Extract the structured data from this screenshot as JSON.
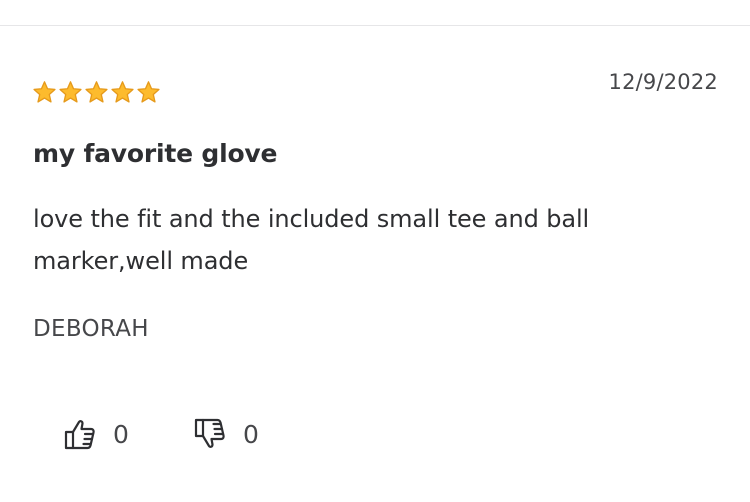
{
  "review": {
    "rating": 5,
    "rating_max": 5,
    "date": "12/9/2022",
    "title": "my favorite glove",
    "body": "love the fit and the included small tee and ball marker,well made",
    "author": "DEBORAH",
    "helpful_count": "0",
    "unhelpful_count": "0"
  },
  "icons": {
    "star": "star-icon",
    "helpful": "thumbs-up-icon",
    "unhelpful": "thumbs-down-icon"
  },
  "colors": {
    "star_fill": "#FDBB2D",
    "star_stroke": "#E69A1B",
    "text": "#2E2F32",
    "muted": "#46474A",
    "divider": "#E6E6E8"
  }
}
